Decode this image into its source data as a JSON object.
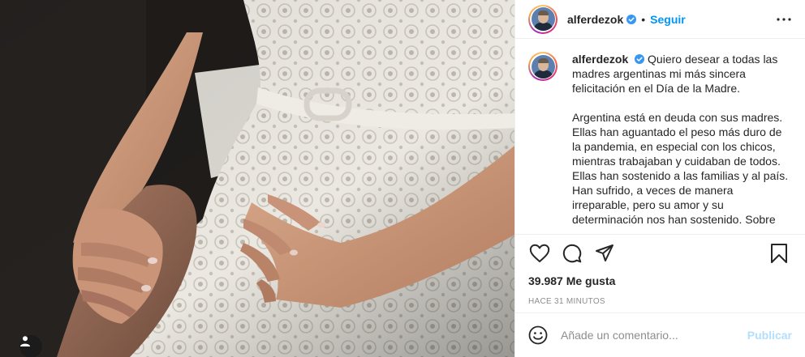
{
  "header": {
    "username": "alferdezok",
    "separator": "•",
    "follow_label": "Seguir"
  },
  "caption": {
    "username": "alferdezok",
    "paragraph_1": "Quiero desear a todas las madres argentinas mi más sincera felicitación en el Día de la Madre.",
    "paragraph_2": "Argentina está en deuda con sus madres. Ellas han aguantado el peso más duro de la pandemia, en especial con los chicos, mientras trabajaban y cuidaban de todos. Ellas han sostenido a las familias y al país. Han sufrido, a veces de manera irreparable, pero su amor y su determinación nos han sostenido. Sobre"
  },
  "icons": {
    "more": "more-options-icon",
    "verified": "verified-badge-icon",
    "like": "heart-icon",
    "comment": "comment-icon",
    "share": "share-icon",
    "save": "bookmark-icon",
    "emoji": "emoji-icon",
    "tag": "user-tag-icon"
  },
  "stats": {
    "likes": "39.987 Me gusta",
    "time": "HACE 31 MINUTOS"
  },
  "comment_box": {
    "placeholder": "Añade un comentario...",
    "publish_label": "Publicar"
  },
  "colors": {
    "accent": "#0095f6",
    "publish_disabled": "#b2dffc",
    "verified": "#3897f0"
  }
}
